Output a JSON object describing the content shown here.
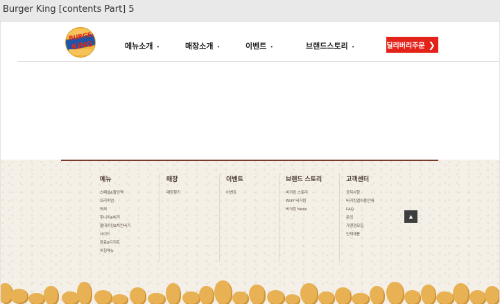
{
  "window": {
    "title": "Burger King [contents Part] 5"
  },
  "header": {
    "logo": {
      "line1": "BURGER",
      "line2": "KING",
      "icon": "burger-king-logo"
    },
    "nav": [
      {
        "label": "메뉴소개"
      },
      {
        "label": "매장소개"
      },
      {
        "label": "이벤트"
      },
      {
        "label": "브랜드스토리"
      }
    ],
    "nav_dot": "•",
    "delivery_button": "딜리버리주문",
    "delivery_chevron": "❯"
  },
  "footer": {
    "columns": [
      {
        "head": "메뉴",
        "links": [
          "스페셜&할인팩",
          "프리미엄",
          "와퍼",
          "주니어&버거",
          "올데이킹&치킨버거",
          "사이드",
          "음료&디저트",
          "아침메뉴"
        ]
      },
      {
        "head": "매장",
        "links": [
          "매장찾기"
        ]
      },
      {
        "head": "이벤트",
        "links": [
          "이벤트"
        ]
      },
      {
        "head": "브랜드 스토리",
        "links": [
          "버거킹 스토리",
          "WHY 버거킹",
          "버거킹 News"
        ]
      },
      {
        "head": "고객센터",
        "links": [
          "공지사항",
          "버거킹앱이용안내",
          "FAQ",
          "문의",
          "가맹점모집",
          "인재채용"
        ]
      }
    ],
    "top_button": "▲",
    "top_icon": "chevron-up-icon"
  },
  "colors": {
    "brand_red": "#e3221a",
    "footer_bg": "#f4f0e7",
    "footer_accent": "#7a3b2a"
  }
}
